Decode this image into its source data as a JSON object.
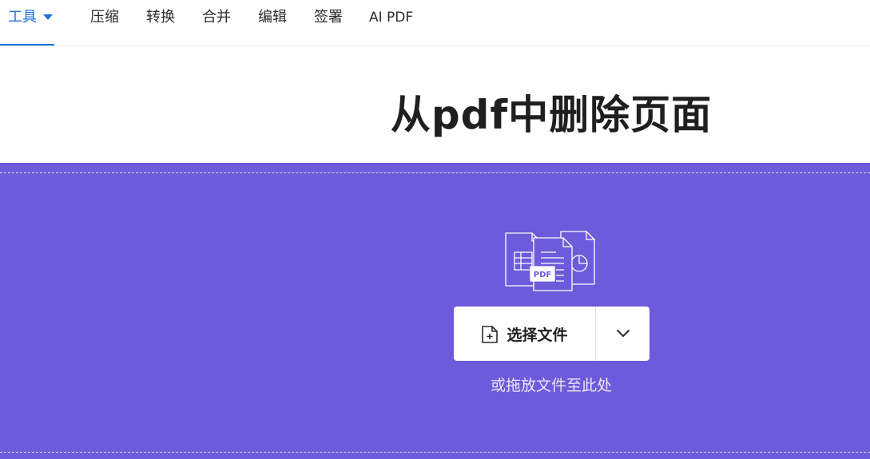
{
  "nav": {
    "items": [
      {
        "label": "工具",
        "active": true
      },
      {
        "label": "压缩"
      },
      {
        "label": "转换"
      },
      {
        "label": "合并"
      },
      {
        "label": "编辑"
      },
      {
        "label": "签署"
      },
      {
        "label": "AI PDF"
      }
    ]
  },
  "page": {
    "title": "从pdf中删除页面"
  },
  "dropzone": {
    "illustration_badge": "PDF",
    "select_button_label": "选择文件",
    "drop_hint": "或拖放文件至此处"
  },
  "colors": {
    "accent": "#1a6fd8",
    "dropzone_bg": "#6e5bdb"
  },
  "icons": {
    "nav_tools": "caret-down-icon",
    "select_button": "add-file-icon",
    "dropdown": "chevron-down-icon"
  }
}
